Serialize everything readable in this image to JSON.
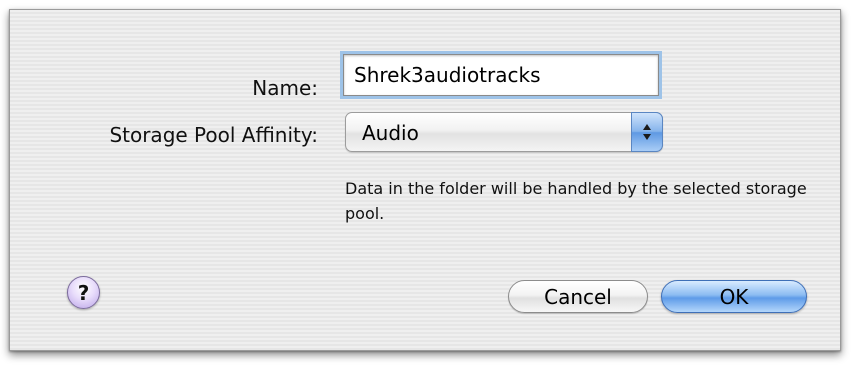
{
  "dialog": {
    "name_label": "Name:",
    "name_value": "Shrek3audiotracks",
    "affinity_label": "Storage Pool Affinity:",
    "affinity_value": "Audio",
    "help_text": "Data in the folder will be handled by the selected storage pool.",
    "help_button": "?",
    "cancel_label": "Cancel",
    "ok_label": "OK"
  },
  "icons": {
    "popup_arrows": "up-down-arrows-icon",
    "help": "question-mark-icon"
  },
  "colors": {
    "focus_ring": "#9ec3e8",
    "default_button": "#5e9be8",
    "help_button": "#b9a3e6"
  }
}
